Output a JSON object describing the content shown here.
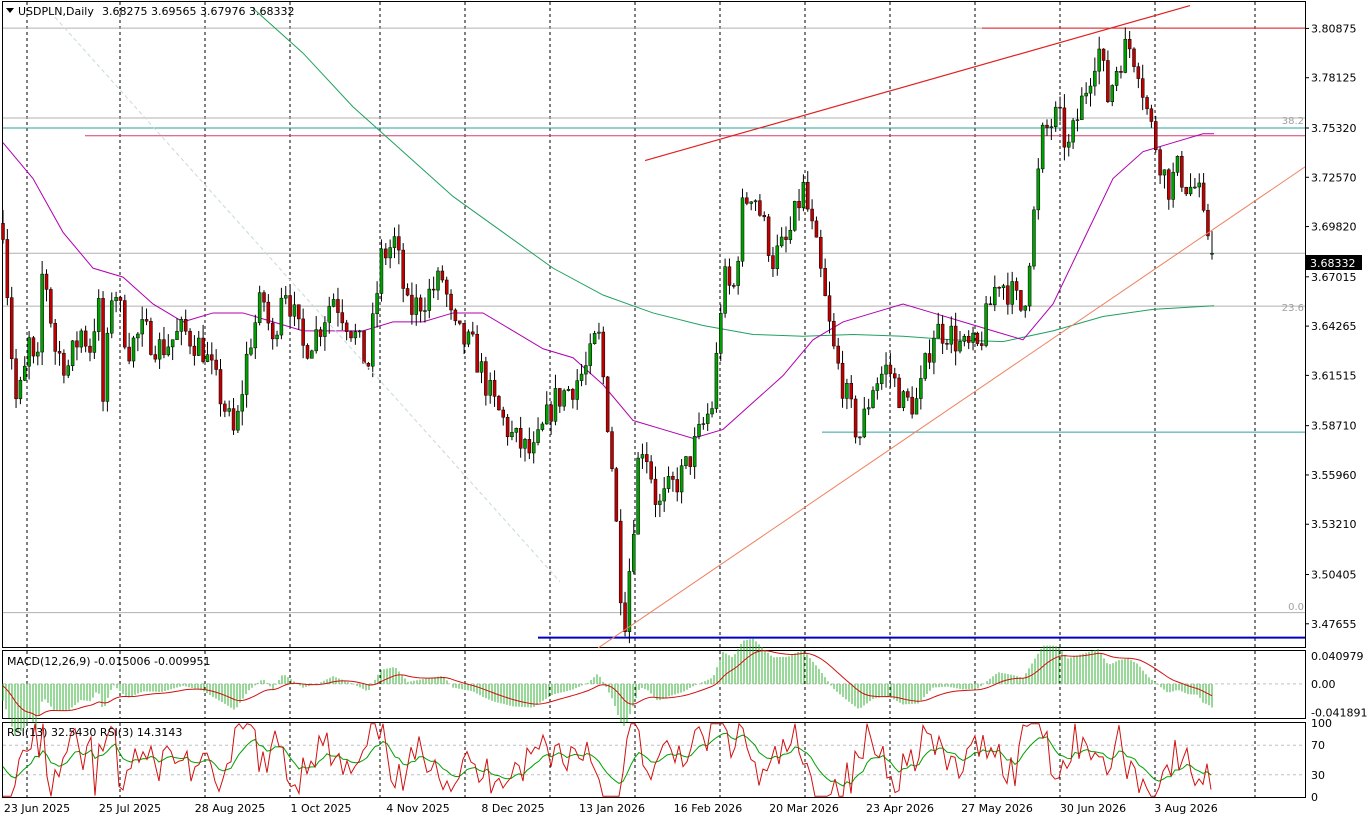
{
  "header": {
    "symbol": "USDPLN,Daily",
    "ohlc": "3.68275 3.69565 3.67976 3.68332"
  },
  "indicators": {
    "macd_label": "MACD(12,26,9) -0.015006 -0.009951",
    "rsi_label": "RSI(13) 32.5430  RSI(3) 14.3143"
  },
  "current_price_label": "3.68332",
  "fib_labels": {
    "f382": "38.2",
    "f236": "23.6",
    "f0": "0.0"
  },
  "colors": {
    "bull": "#00a000",
    "bear": "#c00000",
    "ma_short": "#b000b0",
    "ma_long": "#20a060",
    "trend_red": "#e02020",
    "support_blue": "#0000c0",
    "hline_teal": "#2aa0a0",
    "macd_hist": "#30b030",
    "macd_signal": "#d01010",
    "rsi_slow": "#00a000",
    "rsi_fast": "#d01010"
  },
  "chart_data": [
    {
      "type": "candlestick",
      "title": "USDPLN,Daily",
      "ylim": [
        3.4636,
        3.8235
      ],
      "y_ticks": [
        "3.80875",
        "3.78125",
        "3.75320",
        "3.72570",
        "3.69820",
        "3.67015",
        "3.64265",
        "3.61515",
        "3.58710",
        "3.55960",
        "3.53210",
        "3.50405",
        "3.47655"
      ],
      "y_tick_values": [
        3.80875,
        3.78125,
        3.7532,
        3.7257,
        3.6982,
        3.67015,
        3.64265,
        3.61515,
        3.5871,
        3.5596,
        3.5321,
        3.50405,
        3.47655
      ],
      "x_ticks": [
        "23 Jun 2025",
        "25 Jul 2025",
        "28 Aug 2025",
        "1 Oct 2025",
        "4 Nov 2025",
        "8 Dec 2025",
        "13 Jan 2026",
        "16 Feb 2026",
        "20 Mar 2026",
        "23 Apr 2026",
        "27 May 2026",
        "30 Jun 2026",
        "3 Aug 2026"
      ],
      "last": {
        "open": 3.68275,
        "high": 3.69565,
        "low": 3.67976,
        "close": 3.68332
      },
      "price_path": [
        [
          0,
          3.7
        ],
        [
          12,
          3.6
        ],
        [
          20,
          3.61
        ],
        [
          28,
          3.64
        ],
        [
          33,
          3.6
        ],
        [
          40,
          3.68
        ],
        [
          52,
          3.63
        ],
        [
          65,
          3.62
        ],
        [
          78,
          3.64
        ],
        [
          88,
          3.63
        ],
        [
          95,
          3.66
        ],
        [
          100,
          3.6
        ],
        [
          110,
          3.67
        ],
        [
          125,
          3.63
        ],
        [
          140,
          3.64
        ],
        [
          158,
          3.63
        ],
        [
          180,
          3.64
        ],
        [
          200,
          3.63
        ],
        [
          220,
          3.6
        ],
        [
          232,
          3.58
        ],
        [
          245,
          3.63
        ],
        [
          260,
          3.66
        ],
        [
          270,
          3.63
        ],
        [
          280,
          3.67
        ],
        [
          300,
          3.63
        ],
        [
          315,
          3.64
        ],
        [
          330,
          3.66
        ],
        [
          350,
          3.64
        ],
        [
          365,
          3.62
        ],
        [
          378,
          3.68
        ],
        [
          392,
          3.69
        ],
        [
          405,
          3.65
        ],
        [
          425,
          3.66
        ],
        [
          440,
          3.67
        ],
        [
          450,
          3.64
        ],
        [
          470,
          3.63
        ],
        [
          490,
          3.6
        ],
        [
          510,
          3.58
        ],
        [
          530,
          3.57
        ],
        [
          550,
          3.6
        ],
        [
          570,
          3.61
        ],
        [
          585,
          3.62
        ],
        [
          595,
          3.64
        ],
        [
          603,
          3.6
        ],
        [
          610,
          3.56
        ],
        [
          617,
          3.5
        ],
        [
          622,
          3.48
        ],
        [
          630,
          3.53
        ],
        [
          637,
          3.58
        ],
        [
          645,
          3.57
        ],
        [
          655,
          3.54
        ],
        [
          665,
          3.55
        ],
        [
          680,
          3.56
        ],
        [
          695,
          3.58
        ],
        [
          710,
          3.6
        ],
        [
          720,
          3.67
        ],
        [
          730,
          3.66
        ],
        [
          740,
          3.71
        ],
        [
          750,
          3.72
        ],
        [
          760,
          3.7
        ],
        [
          770,
          3.68
        ],
        [
          785,
          3.69
        ],
        [
          800,
          3.72
        ],
        [
          815,
          3.68
        ],
        [
          830,
          3.63
        ],
        [
          845,
          3.6
        ],
        [
          856,
          3.58
        ],
        [
          870,
          3.61
        ],
        [
          885,
          3.62
        ],
        [
          900,
          3.6
        ],
        [
          915,
          3.6
        ],
        [
          930,
          3.64
        ],
        [
          945,
          3.64
        ],
        [
          960,
          3.63
        ],
        [
          975,
          3.63
        ],
        [
          985,
          3.65
        ],
        [
          995,
          3.67
        ],
        [
          1010,
          3.66
        ],
        [
          1020,
          3.65
        ],
        [
          1030,
          3.7
        ],
        [
          1040,
          3.75
        ],
        [
          1055,
          3.76
        ],
        [
          1065,
          3.74
        ],
        [
          1075,
          3.76
        ],
        [
          1085,
          3.78
        ],
        [
          1095,
          3.8
        ],
        [
          1105,
          3.77
        ],
        [
          1115,
          3.79
        ],
        [
          1125,
          3.8
        ],
        [
          1135,
          3.79
        ],
        [
          1145,
          3.76
        ],
        [
          1155,
          3.74
        ],
        [
          1165,
          3.72
        ],
        [
          1175,
          3.73
        ],
        [
          1185,
          3.72
        ],
        [
          1195,
          3.72
        ],
        [
          1200,
          3.7
        ],
        [
          1205,
          3.695
        ],
        [
          1211,
          3.683
        ]
      ],
      "ma_short_path": [
        [
          0,
          3.745
        ],
        [
          30,
          3.725
        ],
        [
          60,
          3.695
        ],
        [
          90,
          3.675
        ],
        [
          120,
          3.67
        ],
        [
          150,
          3.655
        ],
        [
          180,
          3.645
        ],
        [
          210,
          3.65
        ],
        [
          240,
          3.65
        ],
        [
          270,
          3.645
        ],
        [
          300,
          3.64
        ],
        [
          330,
          3.64
        ],
        [
          360,
          3.64
        ],
        [
          390,
          3.645
        ],
        [
          420,
          3.645
        ],
        [
          450,
          3.65
        ],
        [
          480,
          3.65
        ],
        [
          510,
          3.64
        ],
        [
          540,
          3.63
        ],
        [
          570,
          3.625
        ],
        [
          600,
          3.61
        ],
        [
          630,
          3.59
        ],
        [
          660,
          3.585
        ],
        [
          690,
          3.58
        ],
        [
          720,
          3.585
        ],
        [
          750,
          3.6
        ],
        [
          780,
          3.615
        ],
        [
          810,
          3.635
        ],
        [
          840,
          3.645
        ],
        [
          870,
          3.65
        ],
        [
          900,
          3.655
        ],
        [
          930,
          3.65
        ],
        [
          960,
          3.645
        ],
        [
          990,
          3.64
        ],
        [
          1020,
          3.635
        ],
        [
          1050,
          3.655
        ],
        [
          1080,
          3.69
        ],
        [
          1110,
          3.725
        ],
        [
          1140,
          3.74
        ],
        [
          1170,
          3.745
        ],
        [
          1200,
          3.75
        ],
        [
          1211,
          3.75
        ]
      ],
      "ma_long_path": [
        [
          250,
          3.82
        ],
        [
          300,
          3.795
        ],
        [
          350,
          3.765
        ],
        [
          400,
          3.74
        ],
        [
          450,
          3.715
        ],
        [
          500,
          3.695
        ],
        [
          550,
          3.675
        ],
        [
          600,
          3.66
        ],
        [
          650,
          3.65
        ],
        [
          700,
          3.643
        ],
        [
          750,
          3.638
        ],
        [
          800,
          3.637
        ],
        [
          850,
          3.638
        ],
        [
          900,
          3.637
        ],
        [
          950,
          3.635
        ],
        [
          1000,
          3.634
        ],
        [
          1050,
          3.64
        ],
        [
          1100,
          3.648
        ],
        [
          1150,
          3.652
        ],
        [
          1211,
          3.654
        ]
      ],
      "horizontal_levels": [
        3.8089,
        3.7489,
        3.7532,
        3.5835,
        3.4688
      ],
      "fibonacci": {
        "0.0": 3.4828,
        "23.6": 3.6538,
        "38.2": 3.7588
      }
    },
    {
      "type": "macd",
      "title": "MACD(12,26,9)",
      "values": {
        "macd": -0.015006,
        "signal": -0.009951
      },
      "y_ticks": [
        "0.040979",
        "0.00",
        "-0.041891"
      ],
      "ylim": [
        -0.05,
        0.048
      ]
    },
    {
      "type": "rsi",
      "title": "RSI(13) / RSI(3)",
      "values": {
        "rsi13": 32.543,
        "rsi3": 14.3143
      },
      "y_ticks": [
        "100",
        "70",
        "30",
        "0"
      ],
      "ylim": [
        0,
        100
      ]
    }
  ]
}
